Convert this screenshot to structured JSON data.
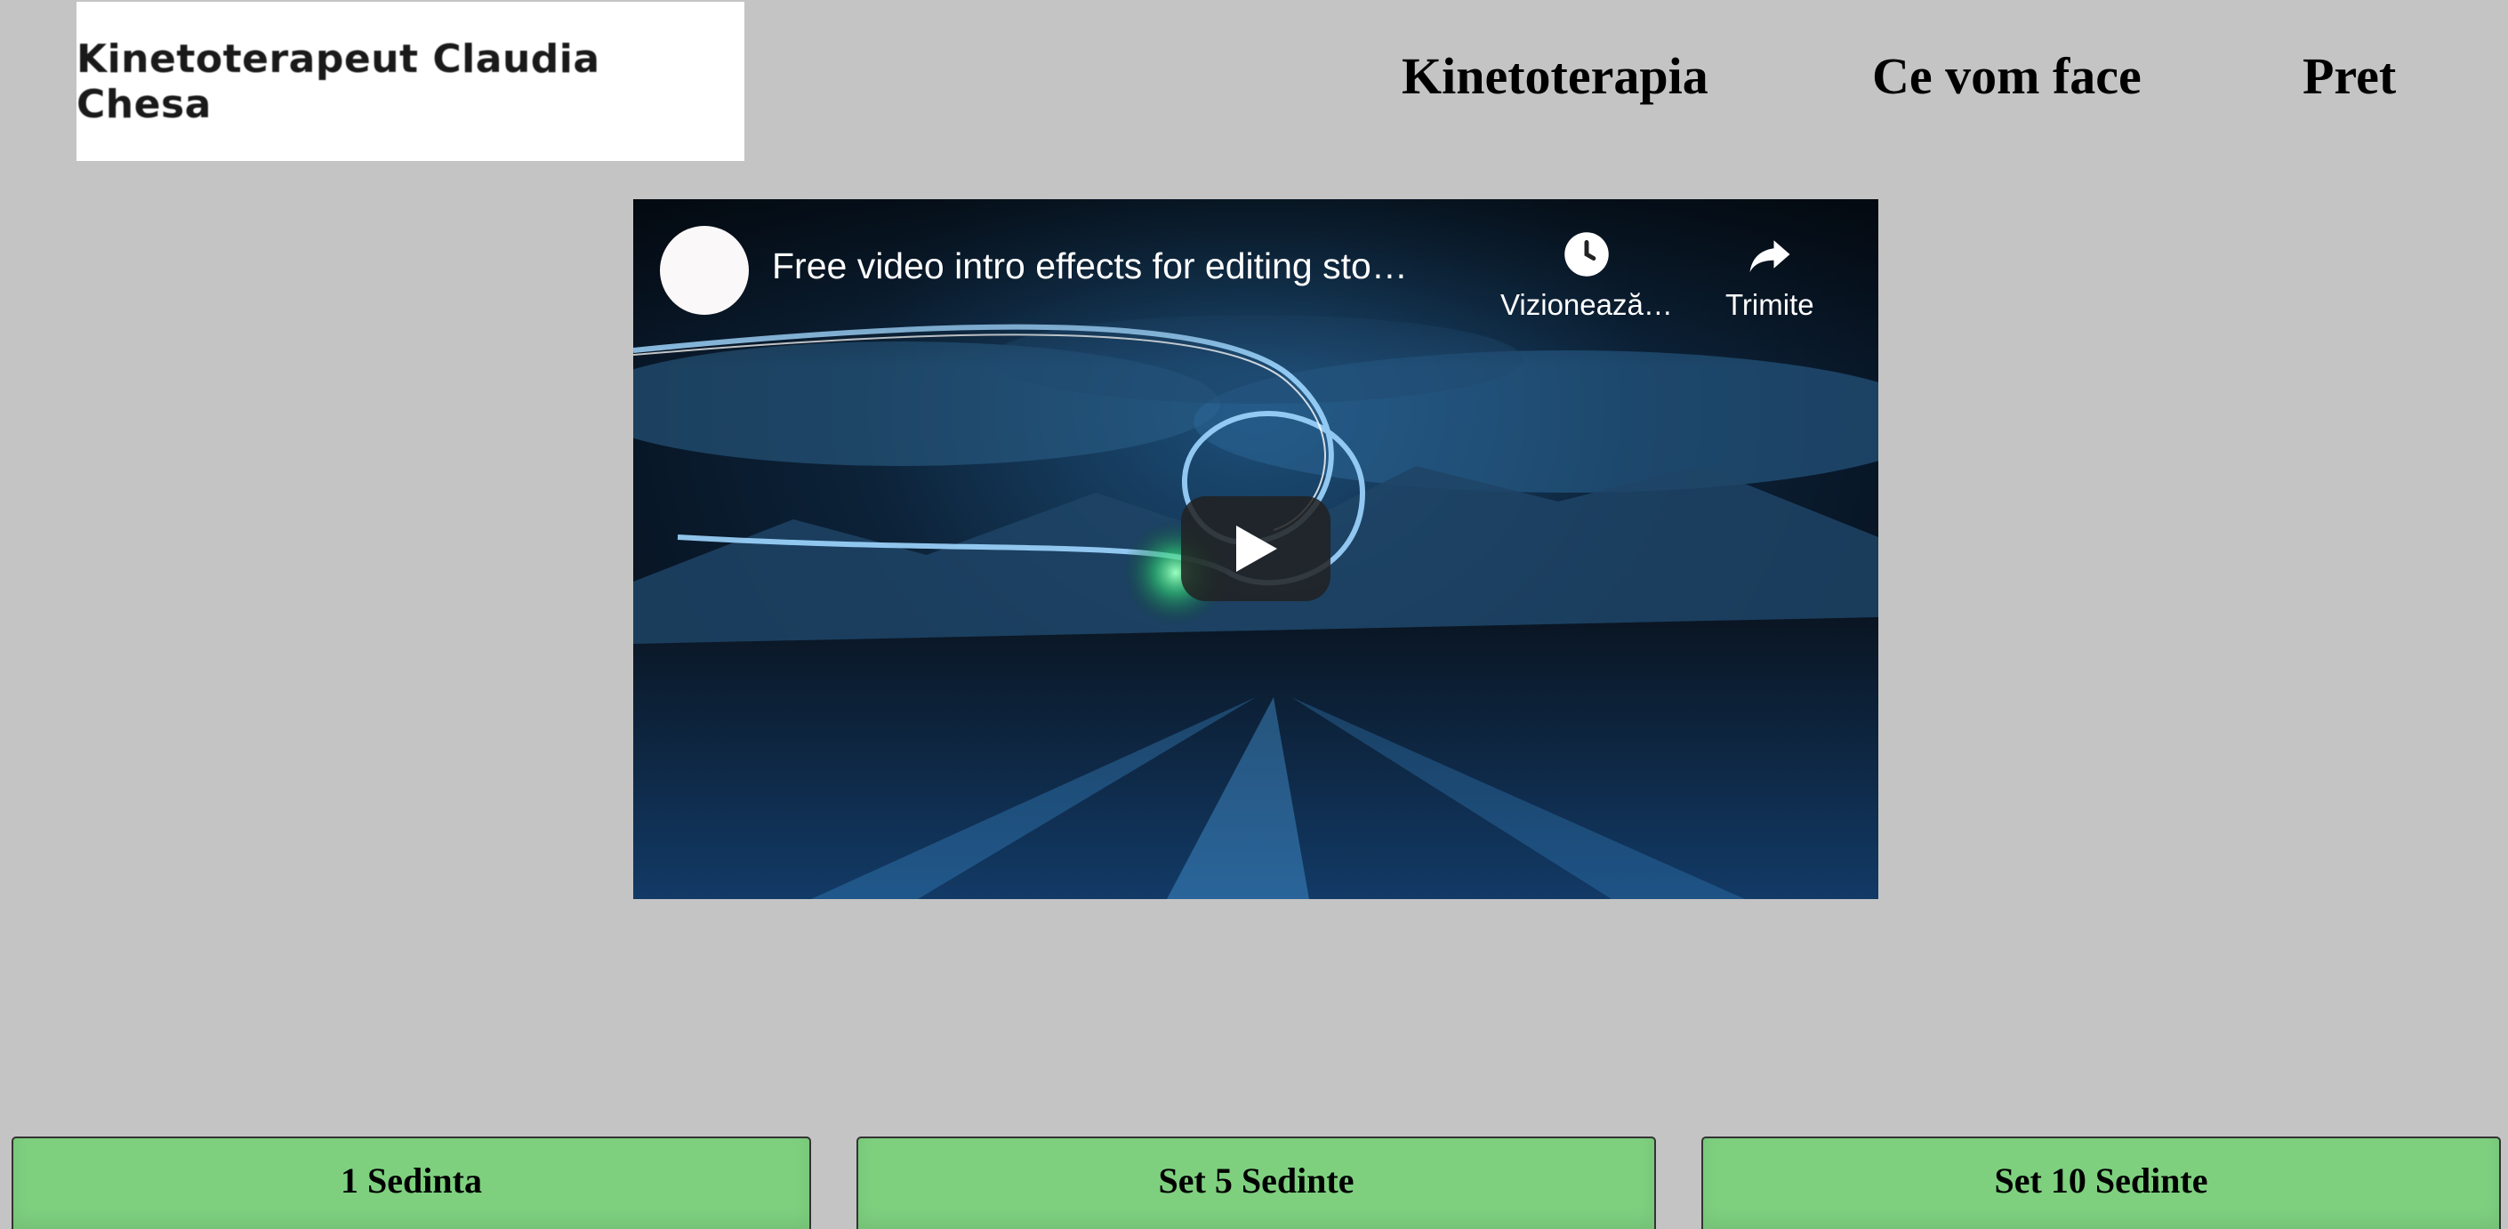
{
  "header": {
    "logo_text": "Kinetoterapeut Claudia Chesa",
    "nav": [
      {
        "label": "Kinetoterapia"
      },
      {
        "label": "Ce vom face"
      },
      {
        "label": "Pret"
      }
    ]
  },
  "video": {
    "title": "Free video intro effects for editing sto…",
    "watch_later_label": "Vizionează…",
    "share_label": "Trimite",
    "icons": {
      "watch_later": "clock-icon",
      "share": "share-arrow-icon",
      "play": "play-icon"
    }
  },
  "pricing": {
    "options": [
      {
        "label": "1 Sedinta"
      },
      {
        "label": "Set 5 Sedinte"
      },
      {
        "label": "Set 10 Sedinte"
      }
    ]
  },
  "colors": {
    "page_background": "#c4c4c4",
    "button_green": "#7ed07f",
    "logo_background": "#ffffff"
  }
}
